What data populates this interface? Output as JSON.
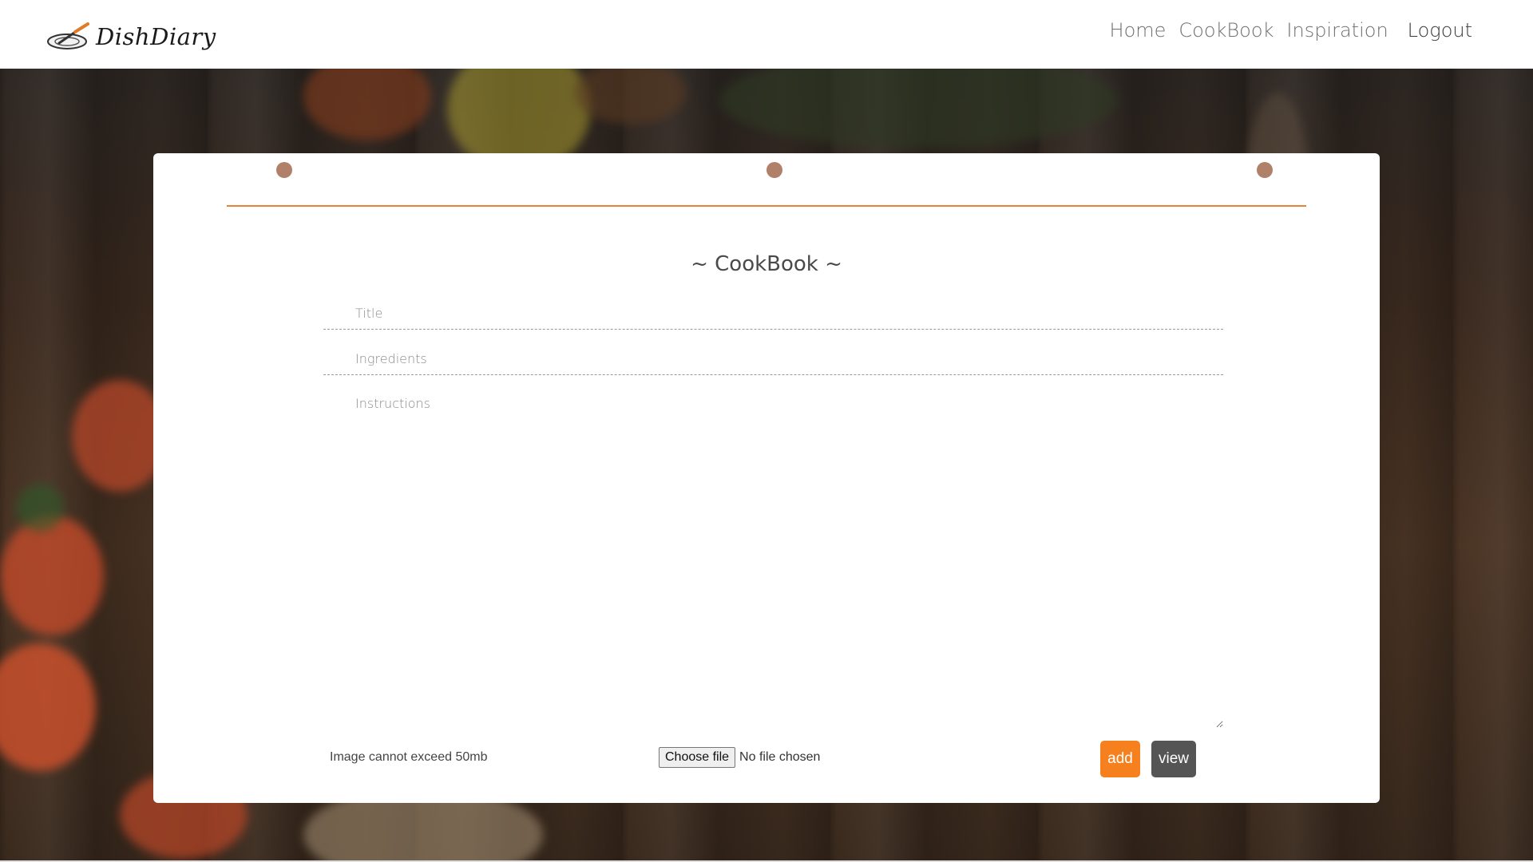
{
  "brand": {
    "name": "DishDiary"
  },
  "nav": {
    "items": [
      "Home",
      "CookBook",
      "Inspiration"
    ],
    "logout": "Logout"
  },
  "form": {
    "heading": "~ CookBook ~",
    "title_placeholder": "Title",
    "ingredients_placeholder": "Ingredients",
    "instructions_placeholder": "Instructions",
    "image_note": "Image cannot exceed 50mb",
    "choose_file_label": "Choose file",
    "no_file_text": "No file chosen",
    "add_label": "add",
    "view_label": "view"
  },
  "colors": {
    "accent": "#f7801e",
    "rule": "#e8843a",
    "dot": "#b08068",
    "view_button": "#555555"
  },
  "icons": {
    "logo": "plate-with-knife-icon"
  }
}
